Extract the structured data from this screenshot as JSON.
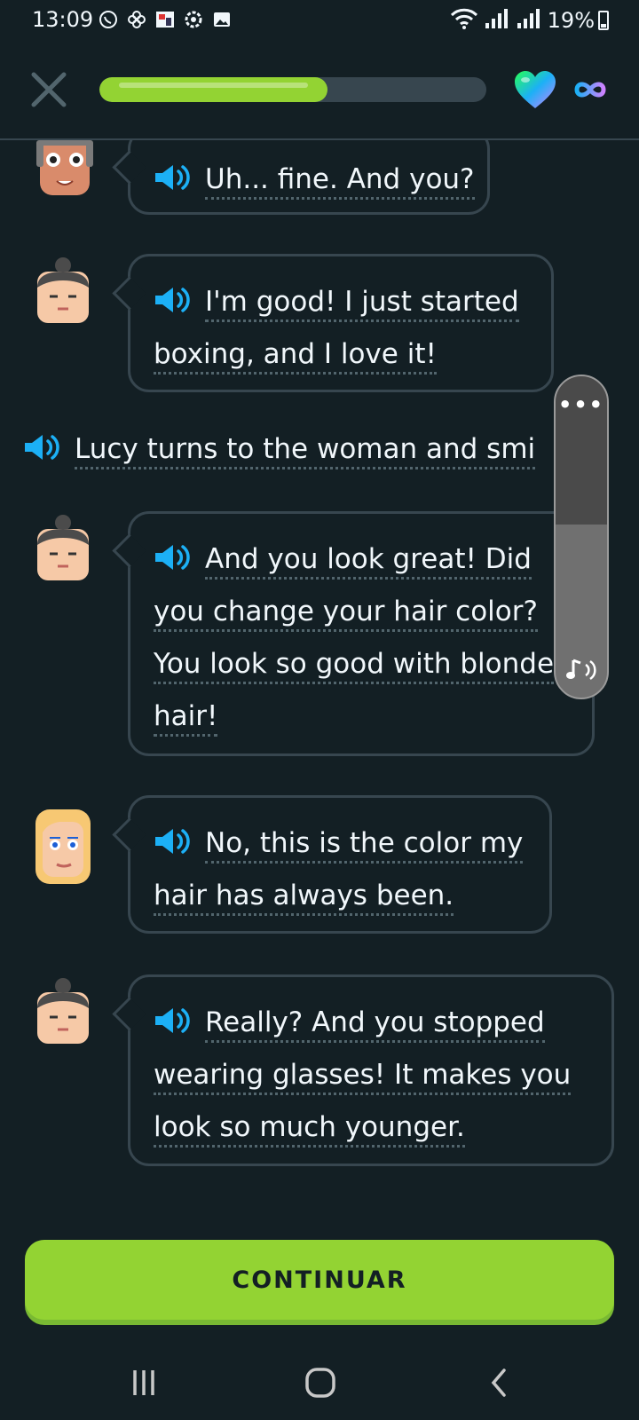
{
  "status_bar": {
    "time": "13:09",
    "battery": "19%"
  },
  "header": {
    "progress": 0.59,
    "hearts": "infinite"
  },
  "messages": [
    {
      "speaker": "man-gray-hair",
      "lines": [
        "Uh... fine. And you?"
      ]
    },
    {
      "speaker": "lucy",
      "lines": [
        "I'm good! I just started",
        "boxing, and I love it!"
      ]
    },
    {
      "speaker": "lucy",
      "lines": [
        "And you look great! Did",
        "you change your hair color?",
        "You look so good with blonde",
        "hair!"
      ]
    },
    {
      "speaker": "blonde-woman",
      "lines": [
        "No, this is the color my",
        "hair has always been."
      ]
    },
    {
      "speaker": "lucy",
      "lines": [
        "Really? And you stopped",
        "wearing glasses! It makes you",
        "look so much younger."
      ]
    }
  ],
  "narration": "Lucy turns to the woman and smi",
  "volume": {
    "level": 0.54,
    "menu_icon": "more-dots-icon",
    "music_icon": "music-note-icon"
  },
  "continue_label": "CONTINUAR",
  "colors": {
    "background": "#131f24",
    "border": "#37464f",
    "accent_green": "#93d333",
    "speaker_blue": "#1cb0f6"
  }
}
